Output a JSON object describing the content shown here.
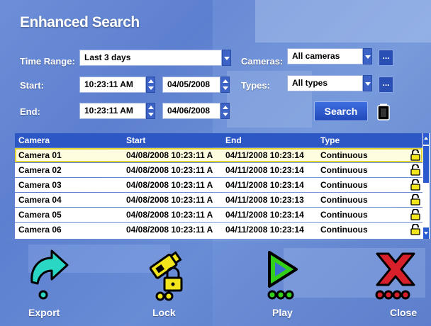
{
  "window": {
    "title": "Enhanced Search"
  },
  "filters": {
    "time_range": {
      "label": "Time Range:",
      "value": "Last 3 days"
    },
    "cameras": {
      "label": "Cameras:",
      "value": "All cameras",
      "browse_label": "..."
    },
    "start": {
      "label": "Start:",
      "time": "10:23:11 AM",
      "date": "04/05/2008"
    },
    "types": {
      "label": "Types:",
      "value": "All types",
      "browse_label": "..."
    },
    "end": {
      "label": "End:",
      "time": "10:23:11 AM",
      "date": "04/06/2008"
    },
    "search_label": "Search"
  },
  "table": {
    "columns": [
      "Camera",
      "Start",
      "End",
      "Type"
    ],
    "rows": [
      {
        "camera": "Camera 01",
        "start": "04/08/2008 10:23:11 A",
        "end": "04/11/2008 10:23:14",
        "type": "Continuous",
        "selected": true
      },
      {
        "camera": "Camera 02",
        "start": "04/08/2008 10:23:11 A",
        "end": "04/11/2008 10:23:14",
        "type": "Continuous"
      },
      {
        "camera": "Camera 03",
        "start": "04/08/2008 10:23:11 A",
        "end": "04/11/2008 10:23:14",
        "type": "Continuous"
      },
      {
        "camera": "Camera 04",
        "start": "04/08/2008 10:23:11 A",
        "end": "04/11/2008 10:23:13",
        "type": "Continuous"
      },
      {
        "camera": "Camera 05",
        "start": "04/08/2008 10:23:11 A",
        "end": "04/11/2008 10:23:14",
        "type": "Continuous"
      },
      {
        "camera": "Camera 06",
        "start": "04/08/2008 10:23:11 A",
        "end": "04/11/2008 10:23:14",
        "type": "Continuous"
      }
    ]
  },
  "toolbar": {
    "export_label": "Export",
    "lock_label": "Lock",
    "play_label": "Play",
    "close_label": "Close"
  },
  "colors": {
    "accent": "#2d57c4",
    "selection_border": "#e5d233",
    "play_green": "#33d01a",
    "close_red": "#d8202a",
    "export_teal": "#2ad6c4",
    "lock_yellow": "#f2e51b"
  },
  "icons": {
    "export": "export-arrow-icon",
    "lock": "camera-lock-icon",
    "play": "play-triangle-icon",
    "close": "red-x-icon",
    "row_lock": "open-padlock-icon",
    "delete": "trash-icon"
  }
}
